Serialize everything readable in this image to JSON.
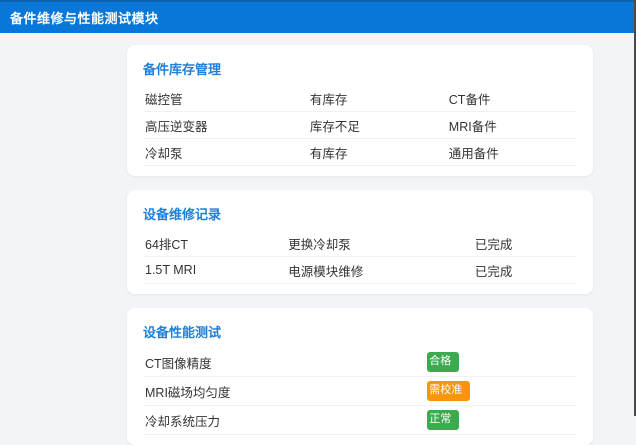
{
  "header": {
    "title": "备件维修与性能测试模块"
  },
  "colors": {
    "header_bg": "#0877d7",
    "section_title": "#1e80d9",
    "badge_green": "#3cab50",
    "badge_orange": "#f8960a",
    "page_bg": "#f3f4f7"
  },
  "cards": [
    {
      "title": "备件库存管理",
      "rows": [
        {
          "c1": "磁控管",
          "c2": "有库存",
          "c3": "CT备件"
        },
        {
          "c1": "高压逆变器",
          "c2": "库存不足",
          "c3": "MRI备件"
        },
        {
          "c1": "冷却泵",
          "c2": "有库存",
          "c3": "通用备件"
        }
      ]
    },
    {
      "title": "设备维修记录",
      "rows": [
        {
          "c1": "64排CT",
          "c2": "更换冷却泵",
          "c3": "已完成"
        },
        {
          "c1": "1.5T MRI",
          "c2": "电源模块维修",
          "c3": "已完成"
        }
      ]
    },
    {
      "title": "设备性能测试",
      "rows": [
        {
          "label": "CT图像精度",
          "badge": "合格",
          "badge_color": "green"
        },
        {
          "label": "MRI磁场均匀度",
          "badge": "需校准",
          "badge_color": "orange"
        },
        {
          "label": "冷却系统压力",
          "badge": "正常",
          "badge_color": "green"
        }
      ]
    }
  ]
}
